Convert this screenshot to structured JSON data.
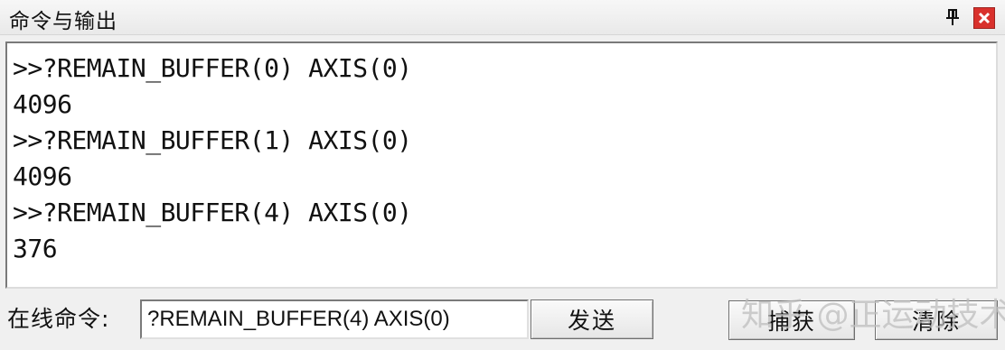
{
  "window": {
    "title": "命令与输出",
    "pin_icon": "pin-icon",
    "close_icon": "close-icon",
    "close_color": "#d9312c"
  },
  "output": {
    "lines": [
      ">>?REMAIN_BUFFER(0) AXIS(0)",
      "4096",
      ">>?REMAIN_BUFFER(1) AXIS(0)",
      "4096",
      ">>?REMAIN_BUFFER(4) AXIS(0)",
      "376"
    ]
  },
  "command": {
    "label": "在线命令:",
    "value": "?REMAIN_BUFFER(4) AXIS(0)",
    "send_label": "发送",
    "capture_label": "捕获",
    "clear_label": "清除"
  },
  "watermark": "知乎 @正运动技术"
}
